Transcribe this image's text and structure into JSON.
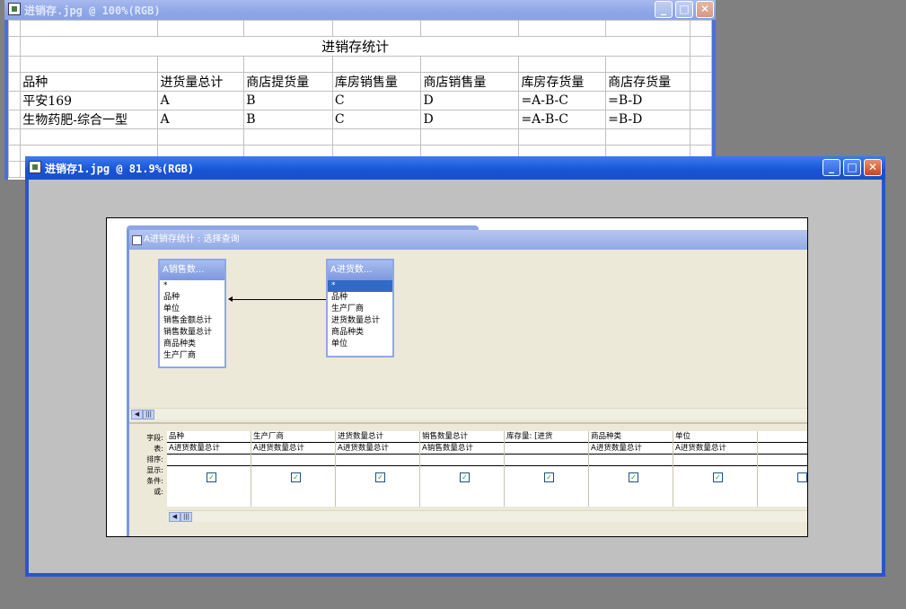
{
  "window1": {
    "title": "进销存.jpg @ 100%(RGB)",
    "sheet_title": "进销存统计",
    "headers": [
      "品种",
      "进货量总计",
      "商店提货量",
      "库房销售量",
      "商店销售量",
      "库房存货量",
      "商店存货量"
    ],
    "rows": [
      [
        "平安169",
        "A",
        "B",
        "C",
        "D",
        "=A-B-C",
        "=B-D"
      ],
      [
        "生物药肥-综合一型",
        "A",
        "B",
        "C",
        "D",
        "=A-B-C",
        "=B-D"
      ]
    ]
  },
  "window2": {
    "title": "进销存1.jpg @ 81.9%(RGB)",
    "query": {
      "title": "A进销存统计 : 选择查询",
      "table_left": {
        "name": "A销售数...",
        "fields": [
          "*",
          "品种",
          "单位",
          "销售金额总计",
          "销售数量总计",
          "商品种类",
          "生产厂商"
        ]
      },
      "table_right": {
        "name": "A进货数...",
        "fields": [
          "*",
          "品种",
          "生产厂商",
          "进货数量总计",
          "商品种类",
          "单位"
        ]
      },
      "row_labels": [
        "字段:",
        "表:",
        "排序:",
        "显示:",
        "条件:",
        "或:"
      ],
      "columns": [
        {
          "field": "品种",
          "table": "A进货数量总计"
        },
        {
          "field": "生产厂商",
          "table": "A进货数量总计"
        },
        {
          "field": "进货数量总计",
          "table": "A进货数量总计"
        },
        {
          "field": "销售数量总计",
          "table": "A销售数量总计"
        },
        {
          "field": "库存量: [进货",
          "table": ""
        },
        {
          "field": "商品种类",
          "table": "A进货数量总计"
        },
        {
          "field": "单位",
          "table": "A进货数量总计"
        }
      ],
      "check_mark": "✓"
    }
  },
  "icons": {
    "minimize": "minimize-icon",
    "maximize": "maximize-icon",
    "close": "close-icon"
  }
}
